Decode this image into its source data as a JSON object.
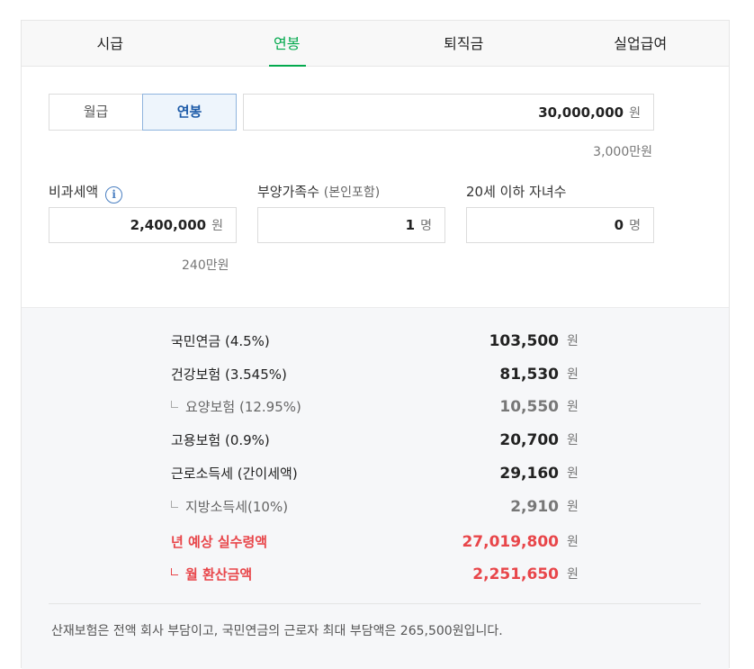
{
  "tabs": [
    {
      "label": "시급"
    },
    {
      "label": "연봉"
    },
    {
      "label": "퇴직금"
    },
    {
      "label": "실업급여"
    }
  ],
  "segment": {
    "monthly": "월급",
    "annual": "연봉"
  },
  "salary": {
    "value": "30,000,000",
    "unit": "원",
    "hint": "3,000만원"
  },
  "nontax": {
    "label": "비과세액",
    "value": "2,400,000",
    "unit": "원",
    "hint": "240만원",
    "info_icon": "i"
  },
  "dependents": {
    "label": "부양가족수",
    "label_sub": "(본인포함)",
    "value": "1",
    "unit": "명"
  },
  "children": {
    "label": "20세 이하 자녀수",
    "value": "0",
    "unit": "명"
  },
  "results": [
    {
      "label": "국민연금 (4.5%)",
      "value": "103,500",
      "unit": "원",
      "kind": "main"
    },
    {
      "label": "건강보험 (3.545%)",
      "value": "81,530",
      "unit": "원",
      "kind": "main"
    },
    {
      "label": "요양보험 (12.95%)",
      "value": "10,550",
      "unit": "원",
      "kind": "sub"
    },
    {
      "label": "고용보험 (0.9%)",
      "value": "20,700",
      "unit": "원",
      "kind": "main"
    },
    {
      "label": "근로소득세 (간이세액)",
      "value": "29,160",
      "unit": "원",
      "kind": "main"
    },
    {
      "label": "지방소득세(10%)",
      "value": "2,910",
      "unit": "원",
      "kind": "sub"
    },
    {
      "label": "년 예상 실수령액",
      "value": "27,019,800",
      "unit": "원",
      "kind": "red"
    },
    {
      "label": "월 환산금액",
      "value": "2,251,650",
      "unit": "원",
      "kind": "red-sub"
    }
  ],
  "note": "산재보험은 전액 회사 부담이고, 국민연금의 근로자 최대 부담액은 265,500원입니다.",
  "colors": {
    "accent": "#03a94d",
    "highlight": "#e8464a",
    "segment_active": "#1d5ba8"
  }
}
